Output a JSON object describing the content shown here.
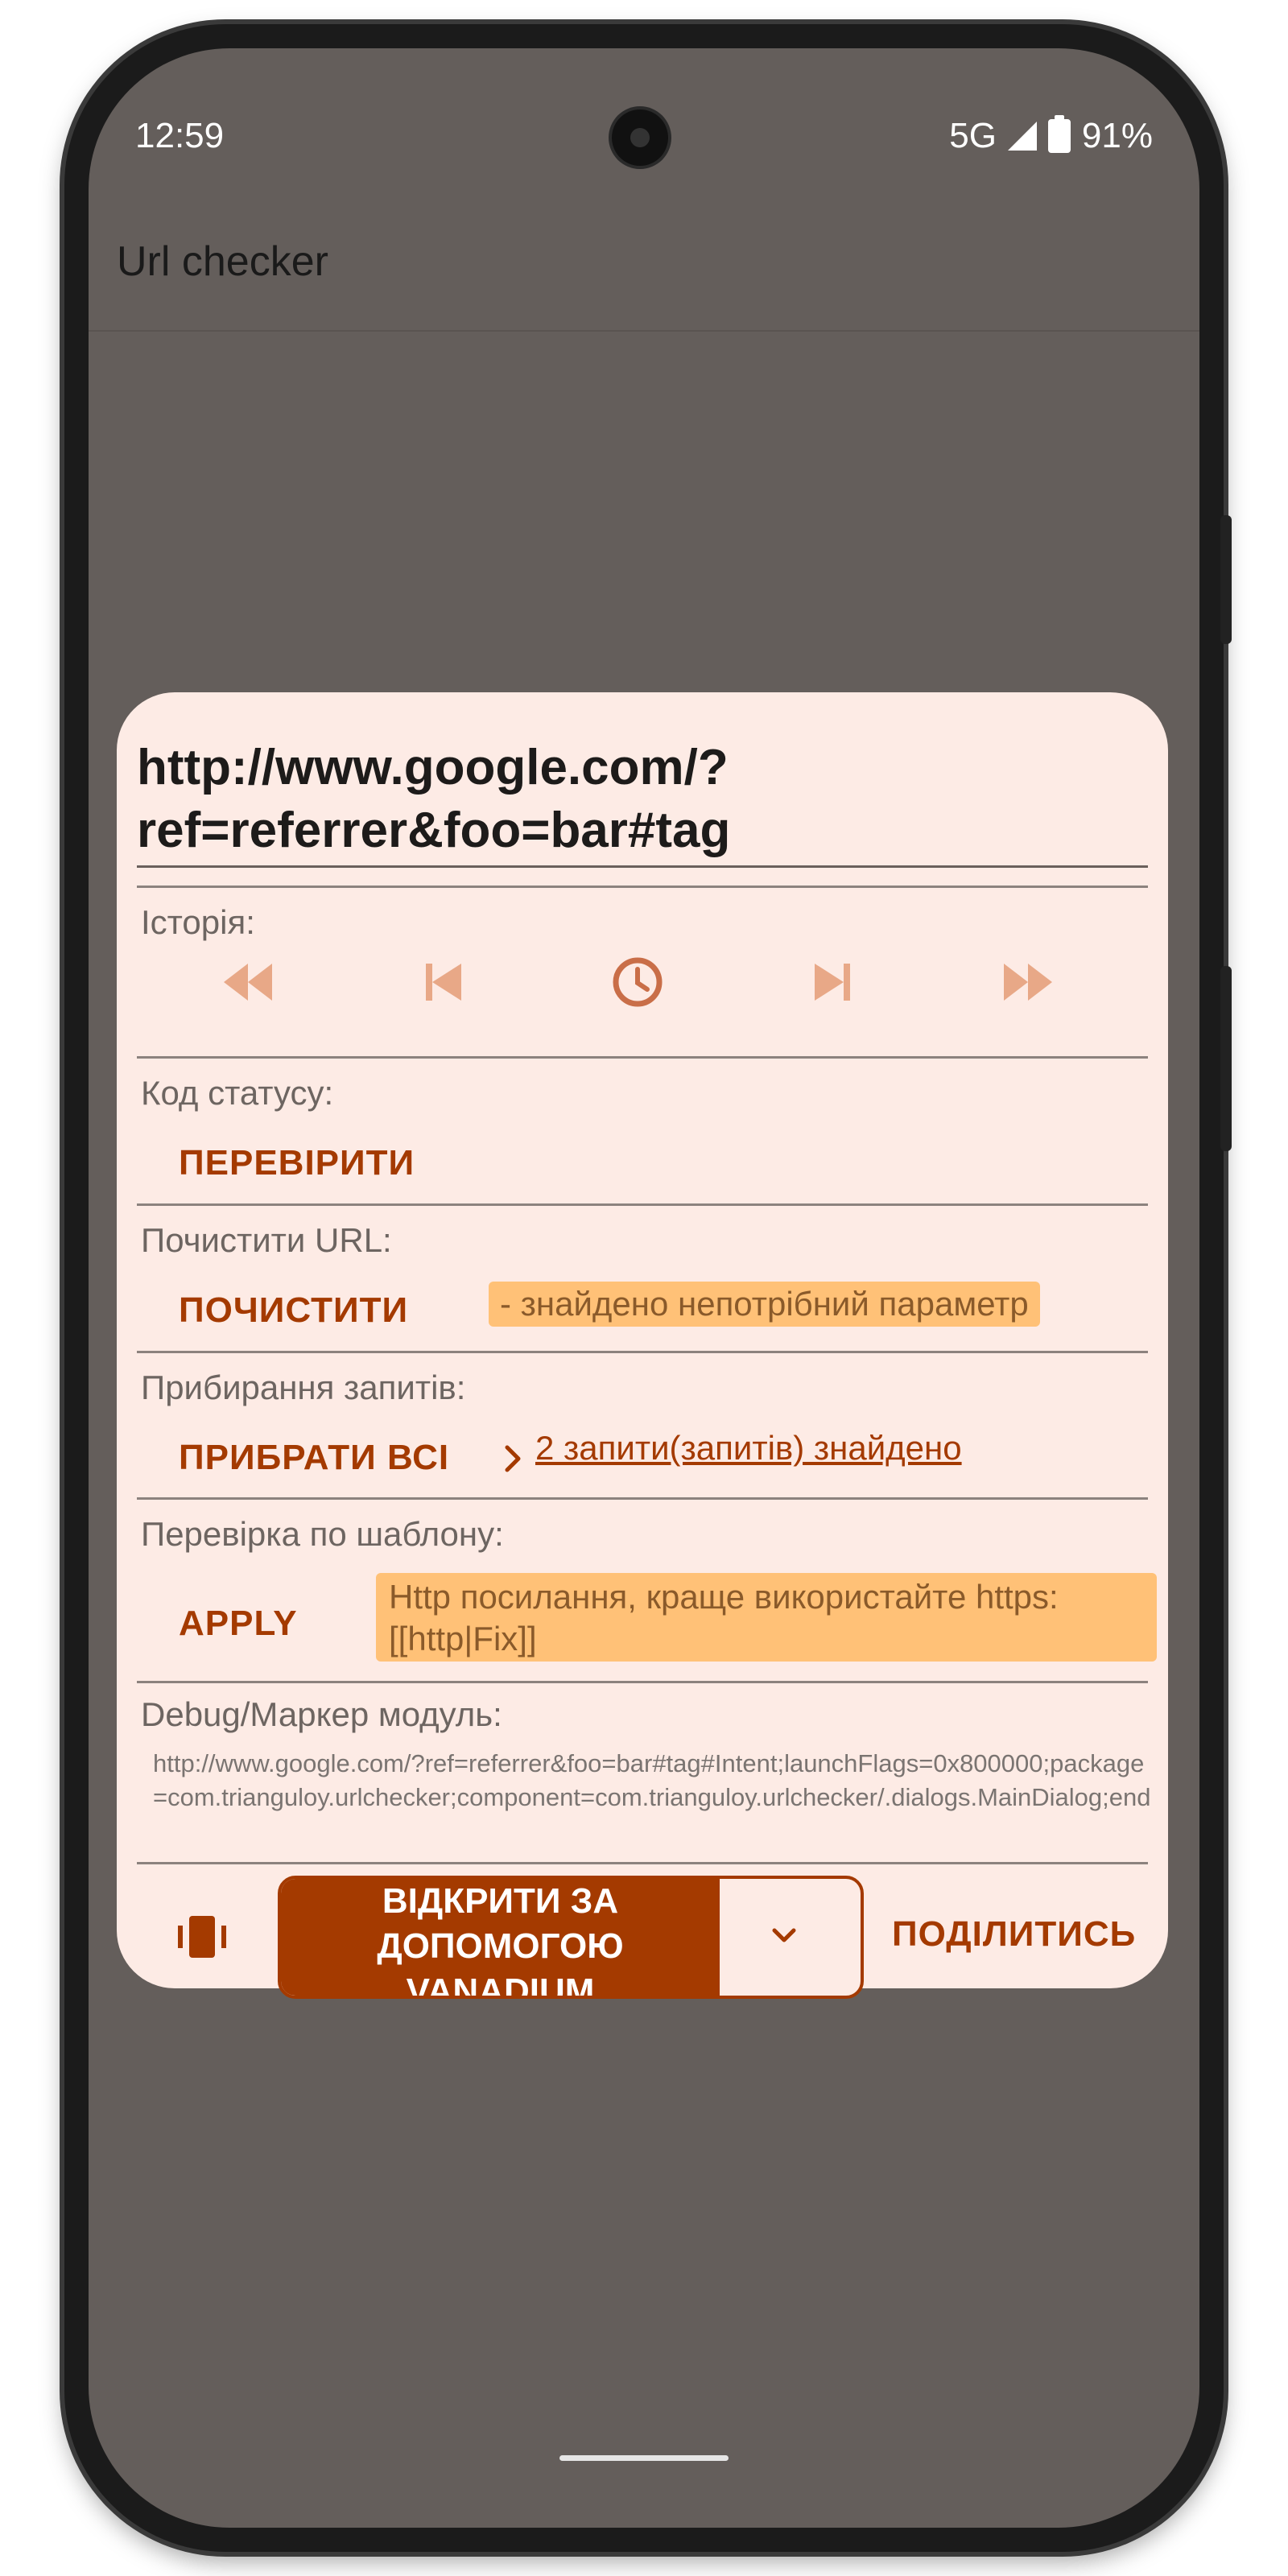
{
  "status_bar": {
    "time": "12:59",
    "network": "5G",
    "battery": "91%"
  },
  "app": {
    "title": "Url checker"
  },
  "dialog": {
    "url": "http://www.google.com/?ref=referrer&foo=bar#tag",
    "history": {
      "label": "Історія:"
    },
    "status_code": {
      "label": "Код статусу:",
      "button": "ПЕРЕВІРИТИ"
    },
    "clean_url": {
      "label": "Почистити URL:",
      "button": "ПОЧИСТИТИ",
      "note": "- знайдено непотрібний параметр"
    },
    "remove_queries": {
      "label": "Прибирання запитів:",
      "button": "ПРИБРАТИ ВСІ",
      "link": "2 запити(запитів) знайдено"
    },
    "pattern_check": {
      "label": "Перевірка по шаблону:",
      "button": "APPLY",
      "note": "Http посилання, краще використайте https: [[http|Fix]]"
    },
    "debug": {
      "label": "Debug/Маркер модуль:",
      "text": "http://www.google.com/?ref=referrer&foo=bar#tag#Intent;launchFlags=0x800000;package=com.trianguloy.urlchecker;component=com.trianguloy.urlchecker/.dialogs.MainDialog;end"
    },
    "bottom": {
      "open_lines": [
        "ВІДКРИТИ ЗА",
        "ДОПОМОГОЮ",
        "VANADIUM"
      ],
      "share": "ПОДІЛИТИСЬ"
    }
  },
  "colors": {
    "accent": "#a43a00",
    "dialog_bg": "#fdebe5",
    "chip_bg": "#ffc177",
    "scrim": "#645e5b"
  },
  "icons": [
    "rewind-icon",
    "skip-previous-icon",
    "history-clock-icon",
    "skip-next-icon",
    "fast-forward-icon",
    "vibrate-icon",
    "chevron-down-icon",
    "chevron-right-icon"
  ]
}
